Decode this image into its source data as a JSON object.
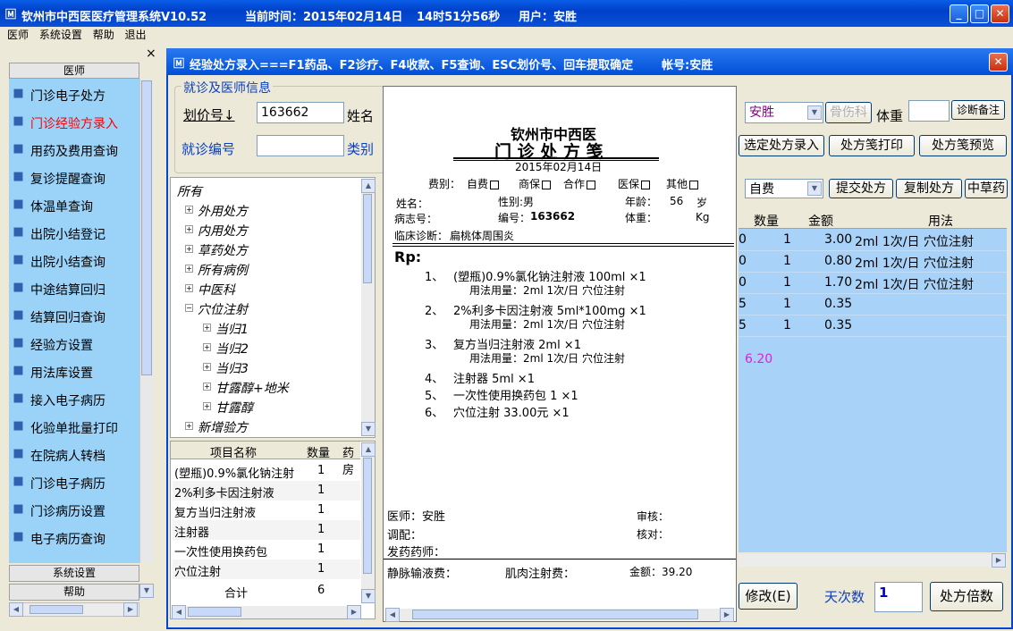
{
  "app": {
    "title": "钦州市中西医医疗管理系统V10.52",
    "time_label": "当前时间：2015年02月14日",
    "time_value": "14时51分56秒",
    "user_label": "用户：安胜"
  },
  "menu": [
    "医师",
    "系统设置",
    "帮助",
    "退出"
  ],
  "left": {
    "header": "医师",
    "close": "×",
    "items": [
      {
        "label": "门诊电子处方",
        "icon": "pen-icon",
        "color": "#000000"
      },
      {
        "label": "门诊经验方录入",
        "icon": "prescription-icon",
        "color": "#ff0000"
      },
      {
        "label": "用药及费用查询",
        "icon": "medicine-icon",
        "color": "#000000"
      },
      {
        "label": "复诊提醒查询",
        "icon": "reminder-icon",
        "color": "#000000"
      },
      {
        "label": "体温单查询",
        "icon": "thermometer-icon",
        "color": "#000000"
      },
      {
        "label": "出院小结登记",
        "icon": "register-icon",
        "color": "#000000"
      },
      {
        "label": "出院小结查询",
        "icon": "bulb-icon",
        "color": "#000000"
      },
      {
        "label": "中途结算回归",
        "icon": "settle-icon",
        "color": "#000000"
      },
      {
        "label": "结算回归查询",
        "icon": "query-icon",
        "color": "#000000"
      },
      {
        "label": "经验方设置",
        "icon": "settings-icon",
        "color": "#000000"
      },
      {
        "label": "用法库设置",
        "icon": "library-icon",
        "color": "#000000"
      },
      {
        "label": "接入电子病历",
        "icon": "connect-icon",
        "color": "#000000"
      },
      {
        "label": "化验单批量打印",
        "icon": "print-icon",
        "color": "#000000"
      },
      {
        "label": "在院病人转档",
        "icon": "transfer-icon",
        "color": "#000000"
      },
      {
        "label": "门诊电子病历",
        "icon": "record-icon",
        "color": "#000000"
      },
      {
        "label": "门诊病历设置",
        "icon": "edit-icon",
        "color": "#000000"
      },
      {
        "label": "电子病历查询",
        "icon": "globe-icon",
        "color": "#000000"
      }
    ],
    "system_settings": "系统设置",
    "help": "帮助"
  },
  "child": {
    "title": "经验处方录入===F1药品、F2诊疗、F4收款、F5查询、ESC划价号、回车提取确定",
    "account": "帐号:安胜"
  },
  "visit_group": {
    "title": "就诊及医师信息",
    "pricing_label": "划价号↓",
    "pricing_value": "163662",
    "name_label": "姓名",
    "visit_label": "就诊编号",
    "visit_value": "",
    "category_label": "类别"
  },
  "tree": {
    "root": "所有",
    "items": [
      {
        "label": "外用处方",
        "sign": "+",
        "level": 1
      },
      {
        "label": "内用处方",
        "sign": "+",
        "level": 1
      },
      {
        "label": "草药处方",
        "sign": "+",
        "level": 1
      },
      {
        "label": "所有病例",
        "sign": "+",
        "level": 1
      },
      {
        "label": "中医科",
        "sign": "+",
        "level": 1
      },
      {
        "label": "穴位注射",
        "sign": "−",
        "level": 1
      },
      {
        "label": "当归1",
        "sign": "+",
        "level": 2
      },
      {
        "label": "当归2",
        "sign": "+",
        "level": 2
      },
      {
        "label": "当归3",
        "sign": "+",
        "level": 2
      },
      {
        "label": "甘露醇+地米",
        "sign": "+",
        "level": 2
      },
      {
        "label": "甘露醇",
        "sign": "+",
        "level": 2
      },
      {
        "label": "新增验方",
        "sign": "+",
        "level": 1
      }
    ]
  },
  "items_table": {
    "headers": [
      "项目名称",
      "数量",
      "药房"
    ],
    "rows": [
      [
        "(塑瓶)0.9%氯化钠注射",
        "1"
      ],
      [
        "2%利多卡因注射液",
        "1"
      ],
      [
        "复方当归注射液",
        "1"
      ],
      [
        "注射器",
        "1"
      ],
      [
        "一次性使用换药包",
        "1"
      ],
      [
        "穴位注射",
        "1"
      ]
    ],
    "total_label": "合计",
    "total_value": "6"
  },
  "rx": {
    "hospital": "钦州市中西医",
    "title": "门 诊 处 方 笺",
    "date": "2015年02月14日",
    "fee_label": "费别：",
    "fee_options": [
      "自费",
      "商保",
      "合作",
      "医保",
      "其他"
    ],
    "name_label": "姓名：",
    "gender": "性别:男",
    "age_label": "年龄：",
    "age": "56",
    "age_unit": "岁",
    "case_label": "病志号：",
    "number_label": "编号：",
    "number": "163662",
    "weight_label": "体重：",
    "weight_unit": "Kg",
    "diagnosis_label": "临床诊断：",
    "diagnosis": "扁桃体周围炎",
    "rp": "Rp:",
    "lines": [
      {
        "no": "1、",
        "text": "(塑瓶)0.9%氯化钠注射液 100ml ×1",
        "usage": "用法用量：2ml 1次/日  穴位注射"
      },
      {
        "no": "2、",
        "text": "2%利多卡因注射液 5ml*100mg ×1",
        "usage": "用法用量：2ml 1次/日 穴位注射"
      },
      {
        "no": "3、",
        "text": "复方当归注射液 2ml ×1",
        "usage": "用法用量：2ml 1次/日 穴位注射"
      },
      {
        "no": "4、",
        "text": "注射器 5ml ×1",
        "usage": ""
      },
      {
        "no": "5、",
        "text": "一次性使用换药包 1 ×1",
        "usage": ""
      },
      {
        "no": "6、",
        "text": "穴位注射  33.00元  ×1",
        "usage": ""
      }
    ],
    "doctor": "医师：安胜",
    "review": "审核：",
    "dispense": "调配：",
    "check": "核对：",
    "pharmacist": "发药药师：",
    "iv_fee": "静脉输液费：",
    "im_fee": "肌肉注射费：",
    "amount": "金额：39.20"
  },
  "right": {
    "doctor": "安胜",
    "dept": "骨伤科",
    "weight_label": "体重",
    "diag_note": "诊断备注",
    "btn_select": "选定处方录入",
    "btn_print": "处方笺打印",
    "btn_preview": "处方笺预览",
    "fee_type": "自费",
    "btn_submit": "提交处方",
    "btn_copy": "复制处方",
    "btn_herb": "中草药",
    "headers": [
      "数量",
      "金额",
      "用法"
    ],
    "rows": [
      {
        "a": "0",
        "qty": "1",
        "amount": "3.00",
        "usage": "2ml 1次/日  穴位注射"
      },
      {
        "a": "0",
        "qty": "1",
        "amount": "0.80",
        "usage": "2ml 1次/日 穴位注射"
      },
      {
        "a": "0",
        "qty": "1",
        "amount": "1.70",
        "usage": "2ml 1次/日 穴位注射"
      },
      {
        "a": "5",
        "qty": "1",
        "amount": "0.35",
        "usage": ""
      },
      {
        "a": "5",
        "qty": "1",
        "amount": "0.35",
        "usage": ""
      }
    ],
    "total": "6.20",
    "total_color": "#e020e0",
    "btn_modify": "修改(E)",
    "days_label": "天次数",
    "days_value": "1",
    "btn_multiple": "处方倍数"
  }
}
